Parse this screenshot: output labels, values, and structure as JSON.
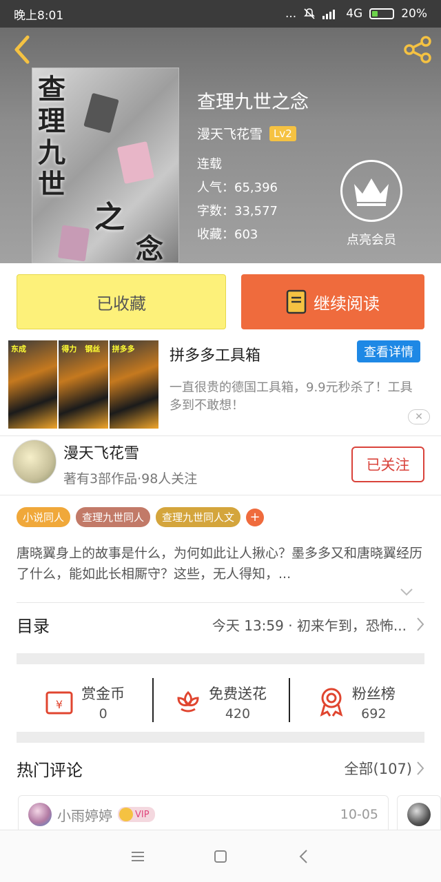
{
  "status_bar": {
    "time": "晚上8:01",
    "indicators": "... ",
    "network": "4G",
    "battery": "20%"
  },
  "book": {
    "title": "查理九世之念",
    "cover_text_a": "查理九世",
    "cover_text_b": "之",
    "cover_text_c": "念",
    "author": "漫天飞花雪",
    "author_level": "Lv2",
    "status": "连载",
    "popularity": "人气：65,396",
    "word_count": "字数：33,577",
    "favorites": "收藏：603",
    "vip_label": "点亮会员"
  },
  "actions": {
    "collected": "已收藏",
    "continue_read": "继续阅读"
  },
  "ad": {
    "title": "拼多多工具箱",
    "detail_button": "查看详情",
    "description": "一直很贵的德国工具箱，9.9元秒杀了！工具多到不敢想！",
    "close": "✕",
    "image_tags": [
      "东成",
      "得力",
      "钢丝",
      "拼多多"
    ]
  },
  "author_card": {
    "name": "漫天飞花雪",
    "summary": "著有3部作品·98人关注",
    "follow_button": "已关注"
  },
  "tags": [
    {
      "label": "小说同人",
      "color": "#f0a83a"
    },
    {
      "label": "查理九世同人",
      "color": "#c27a68"
    },
    {
      "label": "查理九世同人文",
      "color": "#d4a53c"
    }
  ],
  "tag_add": "+",
  "synopsis": "唐晓翼身上的故事是什么，为何如此让人揪心？墨多多又和唐晓翼经历了什么，能如此长相厮守？这些，无人得知，...",
  "toc": {
    "label": "目录",
    "latest": "今天 13:59 · 初来乍到，恐怖..."
  },
  "stats": [
    {
      "label": "赏金币",
      "value": "0"
    },
    {
      "label": "免费送花",
      "value": "420"
    },
    {
      "label": "粉丝榜",
      "value": "692"
    }
  ],
  "comments": {
    "title": "热门评论",
    "all": "全部(107)",
    "items": [
      {
        "user": "小雨婷婷",
        "badge": "VIP",
        "date": "10-05"
      }
    ]
  },
  "colors": {
    "accent": "#ef6b3d",
    "collected_bg": "#fdf17a",
    "follow": "#d9423a",
    "ad_button": "#1e88e5"
  }
}
